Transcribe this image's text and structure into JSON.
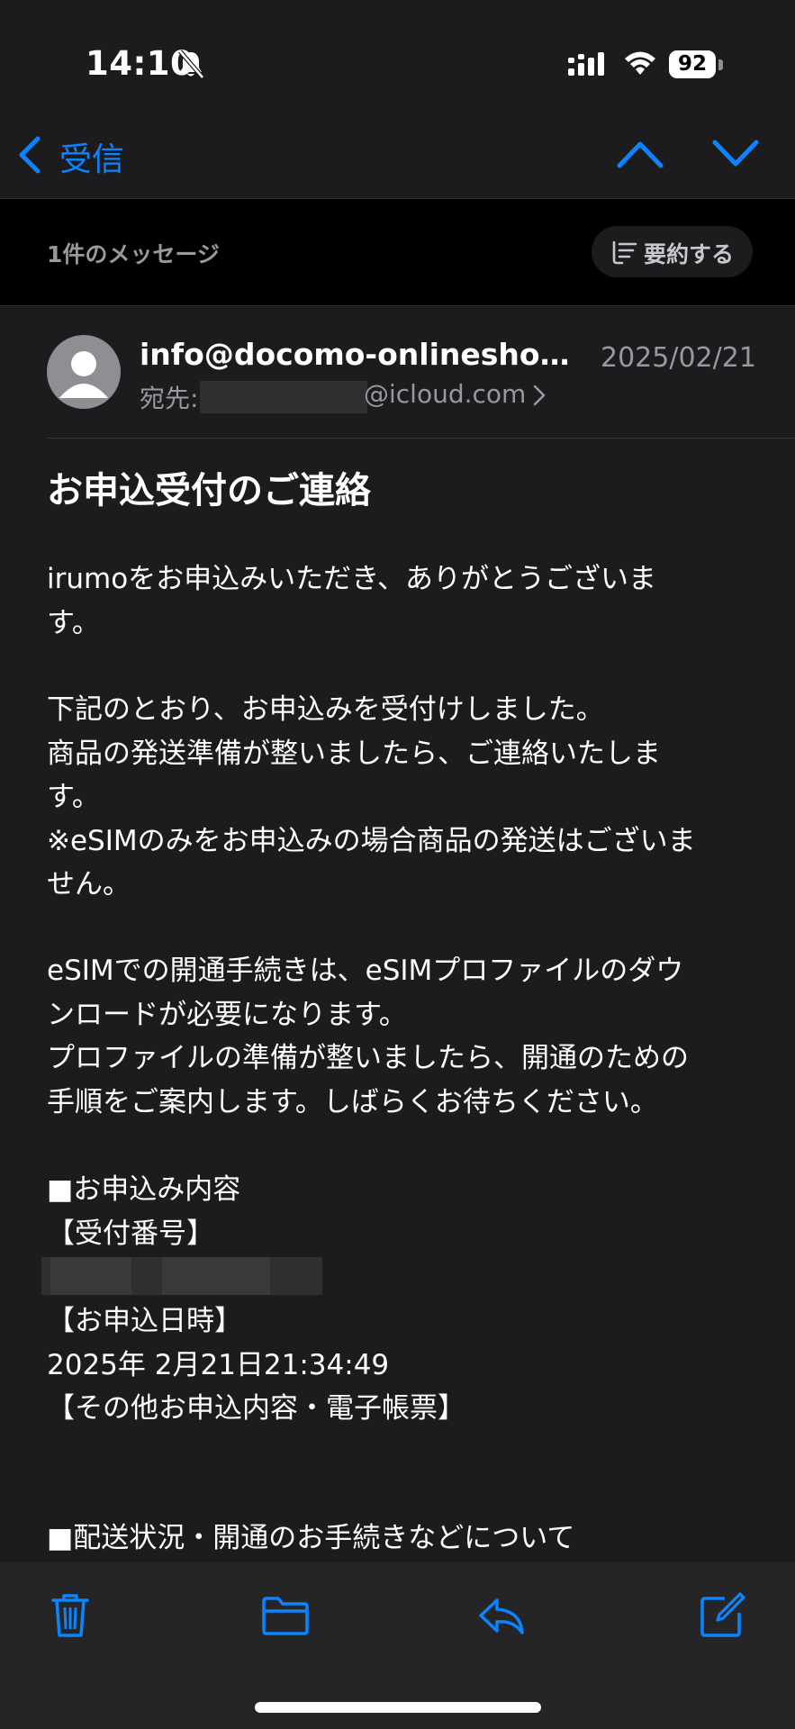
{
  "status": {
    "time": "14:10",
    "battery": "92"
  },
  "nav": {
    "back_label": "受信"
  },
  "thread": {
    "message_count": "1件のメッセージ",
    "summarize_label": "要約する"
  },
  "email": {
    "sender": "info@docomo-onlineshop.n...",
    "date": "2025/02/21",
    "to_label": "宛先:",
    "to_domain": "@icloud.com",
    "subject": "お申込受付のご連絡",
    "paragraphs": [
      "irumoをお申込みいただき、ありがとうございま\nす。",
      "下記のとおり、お申込みを受付けしました。\n商品の発送準備が整いましたら、ご連絡いたしま\nす。\n※eSIMのみをお申込みの場合商品の発送はございま\nせん。",
      "eSIMでの開通手続きは、eSIMプロファイルのダウ\nンロードが必要になります。\nプロファイルの準備が整いましたら、開通のための\n手順をご案内します。しばらくお待ちください。",
      "■お申込み内容\n【受付番号】",
      "【お申込日時】\n2025年 2月21日21:34:49\n【その他お申込内容・電子帳票】",
      "■配送状況・開通のお手続きなどについて"
    ]
  },
  "toolbar": {
    "icons": [
      "trash-icon",
      "folder-icon",
      "reply-icon",
      "compose-icon"
    ]
  },
  "colors": {
    "accent": "#0a84ff",
    "background": "#1c1c1e",
    "toolbar": "#252527"
  }
}
